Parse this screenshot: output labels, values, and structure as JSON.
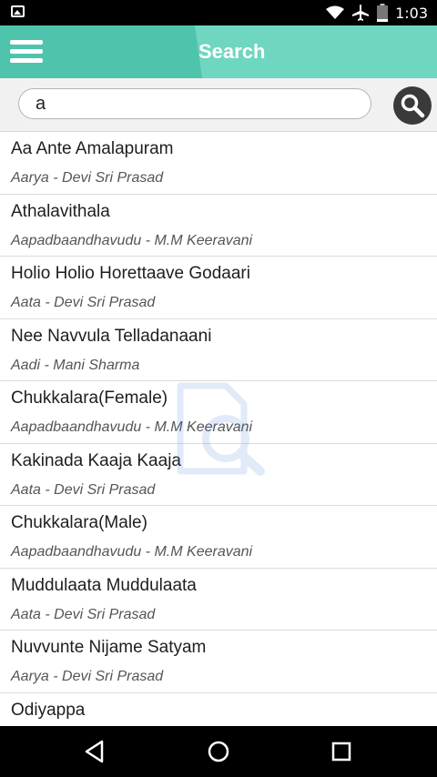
{
  "status_bar": {
    "time": "1:03"
  },
  "app_bar": {
    "title": "Search"
  },
  "search": {
    "value": "a"
  },
  "songs": [
    {
      "title": "Aa Ante Amalapuram",
      "subtitle": "Aarya - Devi Sri Prasad"
    },
    {
      "title": "Athalavithala",
      "subtitle": "Aapadbaandhavudu - M.M Keeravani"
    },
    {
      "title": "Holio Holio Horettaave Godaari",
      "subtitle": "Aata - Devi Sri Prasad"
    },
    {
      "title": "Nee Navvula Telladanaani",
      "subtitle": "Aadi - Mani Sharma"
    },
    {
      "title": "Chukkalara(Female)",
      "subtitle": "Aapadbaandhavudu - M.M Keeravani"
    },
    {
      "title": "Kakinada Kaaja Kaaja",
      "subtitle": "Aata - Devi Sri Prasad"
    },
    {
      "title": "Chukkalara(Male)",
      "subtitle": "Aapadbaandhavudu - M.M Keeravani"
    },
    {
      "title": "Muddulaata Muddulaata",
      "subtitle": "Aata - Devi Sri Prasad"
    },
    {
      "title": "Nuvvunte Nijame Satyam",
      "subtitle": "Aarya - Devi Sri Prasad"
    },
    {
      "title": "Odiyappa",
      "subtitle": ""
    }
  ],
  "colors": {
    "app_bar": "#4fc4ad",
    "app_bar_tab": "#6fd6c0",
    "search_button": "#3a3a3a"
  },
  "icons": {
    "menu": "hamburger-icon",
    "search": "magnifier-icon",
    "watermark": "document-search-icon",
    "back": "back-triangle-icon",
    "home": "home-circle-icon",
    "recents": "recents-square-icon"
  }
}
